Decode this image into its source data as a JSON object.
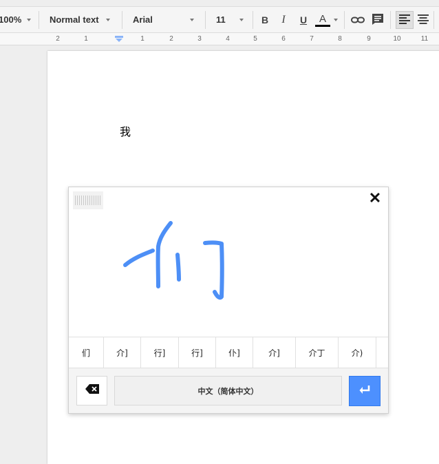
{
  "toolbar": {
    "zoom": "100%",
    "style": "Normal text",
    "font": "Arial",
    "size": "11",
    "bold": "B",
    "italic": "I",
    "underline": "U",
    "text_color": "A"
  },
  "ruler": {
    "numbers": [
      "2",
      "1",
      "1",
      "2",
      "3",
      "4",
      "5",
      "6",
      "7",
      "8",
      "9",
      "10",
      "11"
    ]
  },
  "document": {
    "text": "我"
  },
  "handwriting": {
    "candidates": [
      "们",
      "介]",
      "行]",
      "行]",
      "仆]",
      "介]",
      "介丁",
      "介)"
    ],
    "language": "中文（简体中文）",
    "stroke_color": "#4d8ff6"
  },
  "colors": {
    "enter_button": "#4d90fe"
  }
}
